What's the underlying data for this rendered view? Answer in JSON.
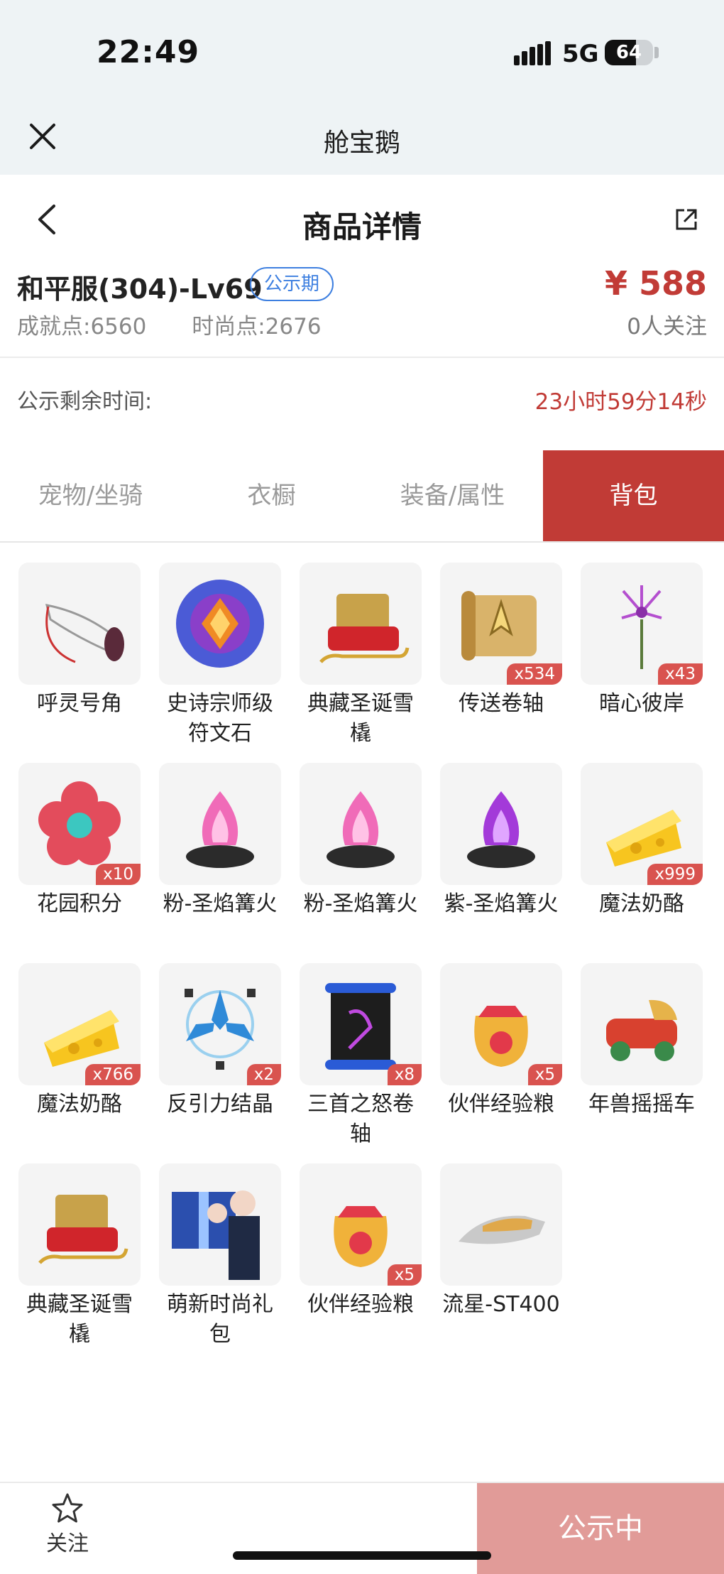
{
  "status_bar": {
    "time": "22:49",
    "network": "5G",
    "battery": "64",
    "battery_level": 0.64
  },
  "app_header": {
    "title": "舱宝鹅"
  },
  "nav": {
    "title": "商品详情"
  },
  "product": {
    "name": "和平服(304)-Lv69",
    "status_badge": "公示期",
    "price": "¥ 588",
    "achievement": "成就点:6560",
    "fashion": "时尚点:2676",
    "followers": "0人关注"
  },
  "remaining": {
    "label": "公示剩余时间:",
    "value": "23小时59分14秒"
  },
  "tabs": [
    {
      "label": "宠物/坐骑"
    },
    {
      "label": "衣橱"
    },
    {
      "label": "装备/属性"
    },
    {
      "label": "背包"
    }
  ],
  "items": [
    {
      "label": "呼灵号角",
      "qty": "",
      "icon": "horn-icon"
    },
    {
      "label": "史诗宗师级符文石",
      "qty": "",
      "icon": "rune-stone-icon"
    },
    {
      "label": "典藏圣诞雪橇",
      "qty": "",
      "icon": "sleigh-icon"
    },
    {
      "label": "传送卷轴",
      "qty": "x534",
      "icon": "scroll-icon"
    },
    {
      "label": "暗心彼岸",
      "qty": "x43",
      "icon": "flower-icon"
    },
    {
      "label": "花园积分",
      "qty": "x10",
      "icon": "garden-flower-icon"
    },
    {
      "label": "粉-圣焰篝火",
      "qty": "",
      "icon": "pink-bonfire-icon"
    },
    {
      "label": "粉-圣焰篝火",
      "qty": "",
      "icon": "pink-bonfire-icon"
    },
    {
      "label": "紫-圣焰篝火",
      "qty": "",
      "icon": "purple-bonfire-icon"
    },
    {
      "label": "魔法奶酪",
      "qty": "x999",
      "icon": "cheese-icon"
    },
    {
      "label": "魔法奶酪",
      "qty": "x766",
      "icon": "cheese-icon"
    },
    {
      "label": "反引力结晶",
      "qty": "x2",
      "icon": "crystal-icon"
    },
    {
      "label": "三首之怒卷轴",
      "qty": "x8",
      "icon": "dark-scroll-icon"
    },
    {
      "label": "伙伴经验粮",
      "qty": "x5",
      "icon": "food-bag-icon"
    },
    {
      "label": "年兽摇摇车",
      "qty": "",
      "icon": "beast-cart-icon"
    },
    {
      "label": "典藏圣诞雪橇",
      "qty": "",
      "icon": "sleigh-icon"
    },
    {
      "label": "萌新时尚礼包",
      "qty": "",
      "icon": "gift-pack-icon"
    },
    {
      "label": "伙伴经验粮",
      "qty": "x5",
      "icon": "food-bag-icon"
    },
    {
      "label": "流星-ST400",
      "qty": "",
      "icon": "hovercraft-icon"
    }
  ],
  "bottom": {
    "follow_label": "关注",
    "status_button": "公示中"
  },
  "colors": {
    "accent": "#c13b36",
    "badge_blue": "#3d7fe0",
    "status_button": "#e19b98"
  }
}
